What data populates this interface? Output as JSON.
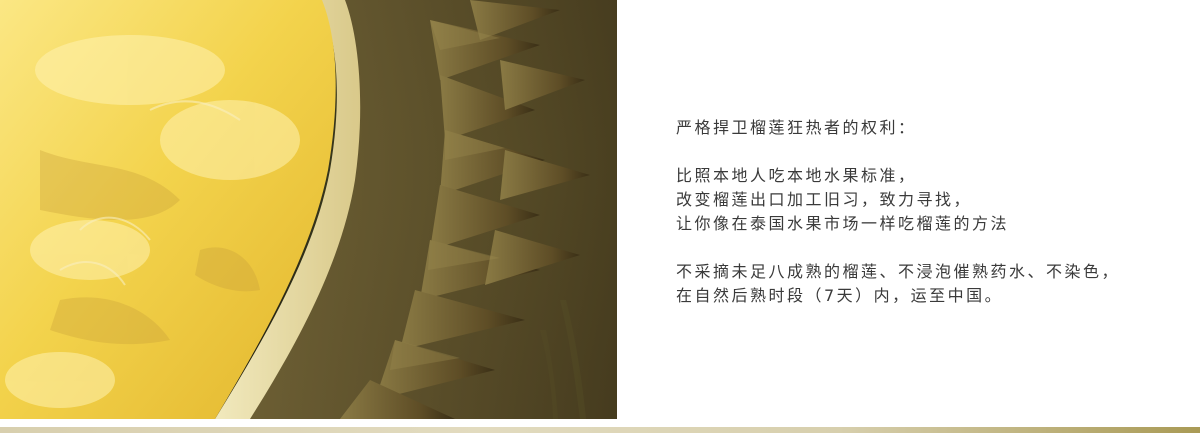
{
  "image": {
    "subject": "durian-closeup-photo"
  },
  "text_block": {
    "heading": "严格捍卫榴莲狂热者的权利：",
    "para2": [
      "比照本地人吃本地水果标准，",
      "改变榴莲出口加工旧习，致力寻找，",
      "让你像在泰国水果市场一样吃榴莲的方法"
    ],
    "para3": [
      "不采摘未足八成熟的榴莲、不浸泡催熟药水、不染色，",
      "在自然后熟时段（7天）内，运至中国。"
    ]
  },
  "colors": {
    "text": "#3a3a3a",
    "flesh": "#f2d24a",
    "husk": "#6b5a2e"
  }
}
